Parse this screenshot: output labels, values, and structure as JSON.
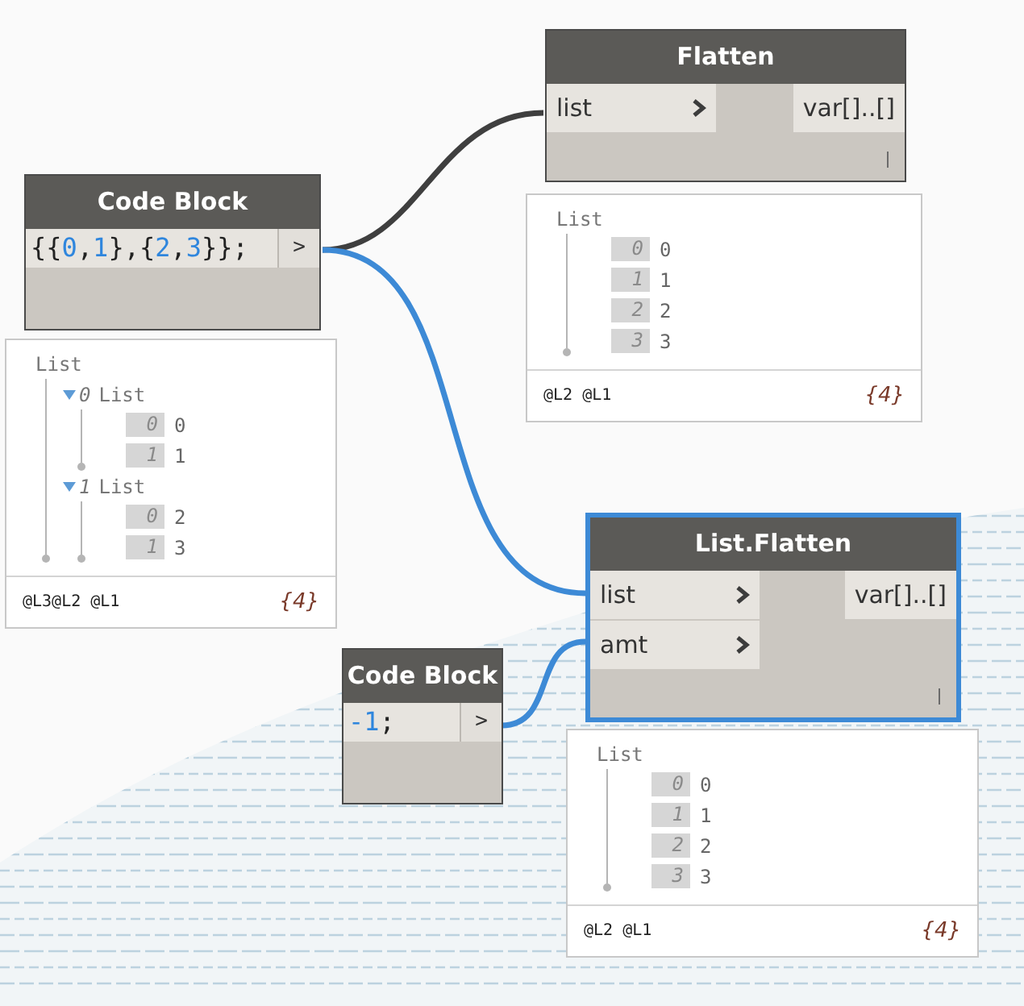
{
  "nodes": [
    {
      "kind": "function",
      "title": "Flatten",
      "selected": false,
      "inputs": [
        {
          "name": "list"
        }
      ],
      "outputs": [
        "var[]..[]"
      ],
      "preview": {
        "label": "List",
        "items": [
          {
            "kind": "value",
            "index": "0",
            "value": "0"
          },
          {
            "kind": "value",
            "index": "1",
            "value": "1"
          },
          {
            "kind": "value",
            "index": "2",
            "value": "2"
          },
          {
            "kind": "value",
            "index": "3",
            "value": "3"
          }
        ],
        "levels": "@L2 @L1",
        "count": "{4}"
      }
    },
    {
      "kind": "code_block",
      "title": "Code Block",
      "selected": false,
      "code": [
        {
          "kind": "punct",
          "text": "{{"
        },
        {
          "kind": "number",
          "text": "0"
        },
        {
          "kind": "punct",
          "text": ","
        },
        {
          "kind": "number",
          "text": "1"
        },
        {
          "kind": "punct",
          "text": "},{"
        },
        {
          "kind": "number",
          "text": "2"
        },
        {
          "kind": "punct",
          "text": ","
        },
        {
          "kind": "number",
          "text": "3"
        },
        {
          "kind": "punct",
          "text": "}};"
        }
      ],
      "output": ">",
      "preview": {
        "label": "List",
        "items": [
          {
            "kind": "list",
            "index": "0",
            "label": "List",
            "expanded": true,
            "children": [
              {
                "kind": "value",
                "index": "0",
                "value": "0"
              },
              {
                "kind": "value",
                "index": "1",
                "value": "1"
              }
            ]
          },
          {
            "kind": "list",
            "index": "1",
            "label": "List",
            "expanded": true,
            "children": [
              {
                "kind": "value",
                "index": "0",
                "value": "2"
              },
              {
                "kind": "value",
                "index": "1",
                "value": "3"
              }
            ]
          }
        ],
        "levels": "@L3@L2 @L1",
        "count": "{4}"
      }
    },
    {
      "kind": "function",
      "title": "List.Flatten",
      "selected": true,
      "inputs": [
        {
          "name": "list"
        },
        {
          "name": "amt"
        }
      ],
      "outputs": [
        "var[]..[]"
      ],
      "preview": {
        "label": "List",
        "items": [
          {
            "kind": "value",
            "index": "0",
            "value": "0"
          },
          {
            "kind": "value",
            "index": "1",
            "value": "1"
          },
          {
            "kind": "value",
            "index": "2",
            "value": "2"
          },
          {
            "kind": "value",
            "index": "3",
            "value": "3"
          }
        ],
        "levels": "@L2 @L1",
        "count": "{4}"
      }
    },
    {
      "kind": "code_block",
      "title": "Code Block",
      "selected": false,
      "code": [
        {
          "kind": "number",
          "text": "-1"
        },
        {
          "kind": "punct",
          "text": ";"
        }
      ],
      "output": ">"
    }
  ]
}
